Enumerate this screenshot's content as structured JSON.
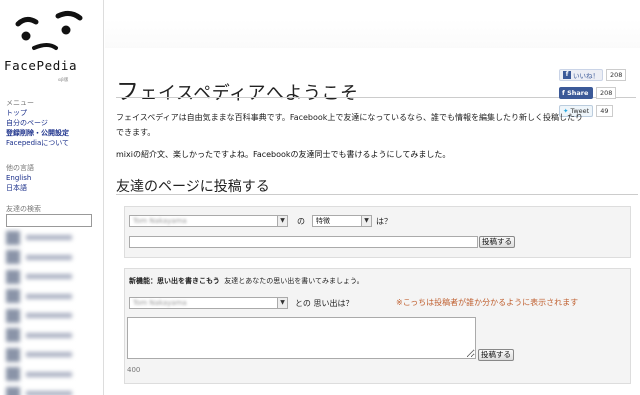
{
  "logo": {
    "name": "FacePedia",
    "sub": "αβ版"
  },
  "menu": {
    "heading": "メニュー",
    "items": [
      {
        "label": "トップ",
        "bold": false
      },
      {
        "label": "自分のページ",
        "bold": false
      },
      {
        "label": "登録削除・公開設定",
        "bold": true
      },
      {
        "label": "Facepediaについて",
        "bold": false
      }
    ]
  },
  "languages": {
    "heading": "他の言語",
    "items": [
      "English",
      "日本語"
    ]
  },
  "friend_search": {
    "label": "友達の検索"
  },
  "social": {
    "like_label": "いいね！",
    "like_count": "208",
    "share_label": "Share",
    "share_count": "208",
    "tweet_label": "Tweet",
    "tweet_count": "49"
  },
  "main": {
    "title_cap": "フ",
    "title_rest": "ェイスペディアへようこそ",
    "intro": "フェイスペディアは自由気ままな百科事典です。Facebook上で友達になっているなら、誰でも情報を編集したり新しく投稿したりできます。",
    "mixi_note": "mixiの紹介文、楽しかったですよね。Facebookの友達同士でも書けるようにしてみました。",
    "section_title": "友達のページに投稿する"
  },
  "post_form": {
    "friend_select_value": "Tom Nakayama",
    "particle_no": "の",
    "attribute_select_value": "特徴",
    "question": "は？",
    "submit_label": "投稿する"
  },
  "memory_form": {
    "header_bold": "新機能：思い出を書きこもう",
    "header_text": "友達とあなたの思い出を書いてみましょう。",
    "friend_select_value": "Tom Nakayama",
    "label": "との 思い出は？",
    "notice": "※こっちは投稿者が誰か分かるように表示されます",
    "submit_label": "投稿する",
    "char_count": "400"
  },
  "colors": {
    "link": "#1a2f8a",
    "notice": "#c06030",
    "facebook": "#3b5998"
  }
}
